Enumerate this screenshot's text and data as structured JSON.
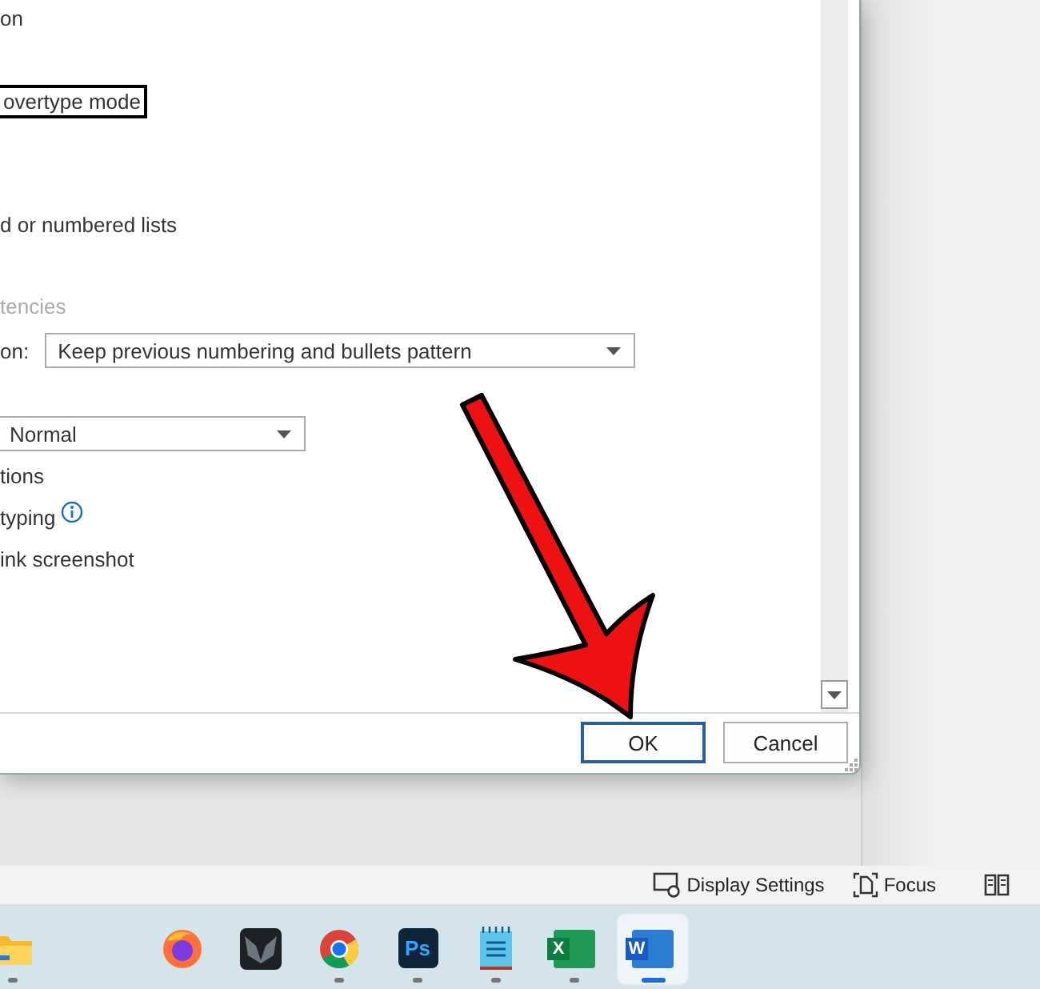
{
  "dialog": {
    "lines": [
      {
        "kind": "text",
        "text": "on",
        "disabled": false
      },
      {
        "kind": "focused",
        "text": "overtype mode",
        "disabled": false
      },
      {
        "kind": "text",
        "text": "d or numbered lists",
        "disabled": false
      },
      {
        "kind": "text",
        "text": "tencies",
        "disabled": true
      },
      {
        "kind": "select",
        "label": "on:",
        "value": "Keep previous numbering and bullets pattern"
      },
      {
        "kind": "select",
        "value": "Normal"
      },
      {
        "kind": "text",
        "text": "tions",
        "disabled": false
      },
      {
        "kind": "text",
        "text": "typing",
        "disabled": false,
        "info": true
      },
      {
        "kind": "text",
        "text": "ink screenshot",
        "disabled": false
      }
    ],
    "buttons": [
      {
        "label": "OK",
        "default": true
      },
      {
        "label": "Cancel",
        "default": false
      }
    ]
  },
  "status_bar": [
    {
      "kind": "display",
      "label": "Display Settings"
    },
    {
      "kind": "focus",
      "label": "Focus"
    },
    {
      "kind": "read"
    }
  ],
  "taskbar": [
    {
      "kind": "folder",
      "running": true,
      "selected": false
    },
    {
      "kind": "browser",
      "running": false,
      "selected": false
    },
    {
      "kind": "mask",
      "running": false,
      "selected": false
    },
    {
      "kind": "wheel",
      "running": true,
      "selected": false
    },
    {
      "kind": "letter",
      "letter": "Ps",
      "running": true,
      "selected": false
    },
    {
      "kind": "notepad",
      "running": true,
      "selected": false
    },
    {
      "kind": "sheet",
      "letter": "X",
      "running": true,
      "selected": false
    },
    {
      "kind": "doc",
      "letter": "W",
      "running": true,
      "selected": true
    }
  ]
}
